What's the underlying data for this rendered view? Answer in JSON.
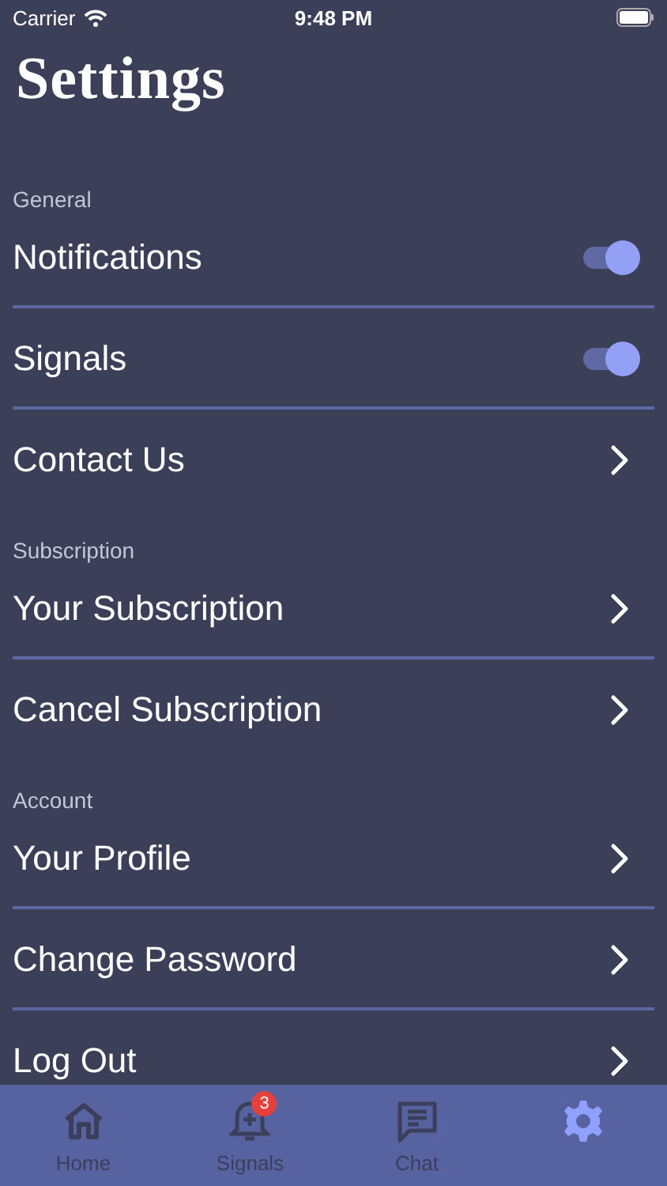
{
  "status_bar": {
    "carrier": "Carrier",
    "time": "9:48 PM"
  },
  "title": "Settings",
  "sections": [
    {
      "header": "General",
      "rows": [
        {
          "label": "Notifications",
          "kind": "toggle",
          "on": true
        },
        {
          "label": "Signals",
          "kind": "toggle",
          "on": true
        },
        {
          "label": "Contact Us",
          "kind": "link"
        }
      ]
    },
    {
      "header": "Subscription",
      "rows": [
        {
          "label": "Your Subscription",
          "kind": "link"
        },
        {
          "label": "Cancel Subscription",
          "kind": "link"
        }
      ]
    },
    {
      "header": "Account",
      "rows": [
        {
          "label": "Your Profile",
          "kind": "link"
        },
        {
          "label": "Change Password",
          "kind": "link"
        },
        {
          "label": "Log Out",
          "kind": "link"
        }
      ]
    }
  ],
  "tab_bar": [
    {
      "kind": "home",
      "label": "Home",
      "selected": false
    },
    {
      "kind": "bell",
      "label": "Signals",
      "badge": "3",
      "selected": false
    },
    {
      "kind": "chat",
      "label": "Chat",
      "selected": false
    },
    {
      "kind": "gear",
      "selected": true
    }
  ]
}
